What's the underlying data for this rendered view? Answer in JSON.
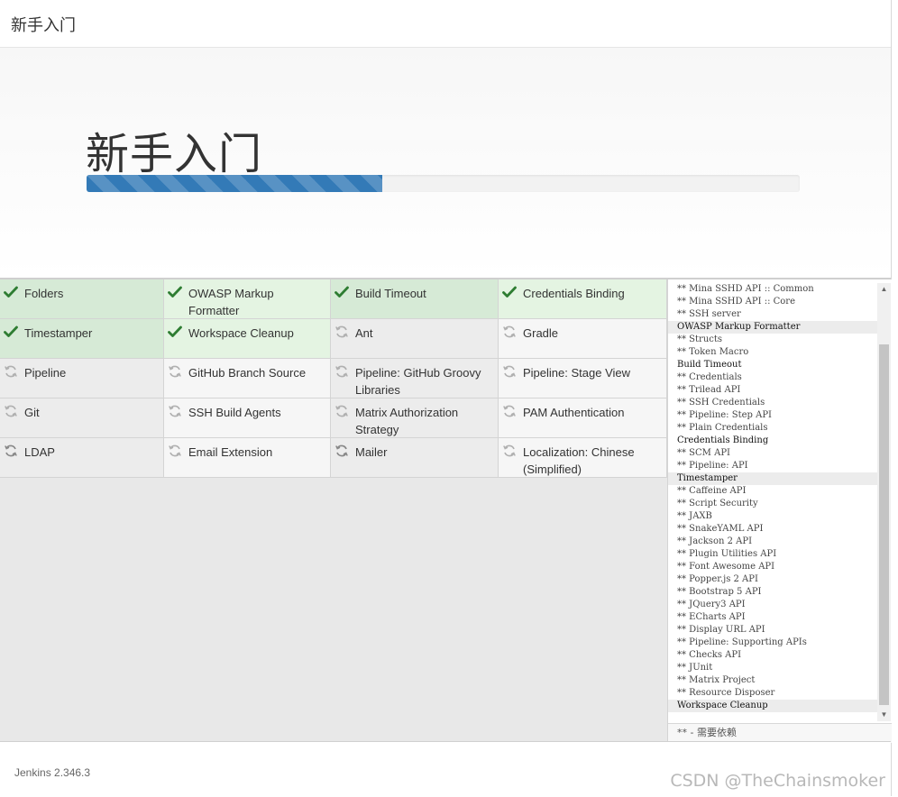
{
  "window_title": "新手入门",
  "hero": {
    "title": "新手入门",
    "progress_fraction": 0.415
  },
  "plugins": [
    {
      "label": "Folders",
      "status": "success"
    },
    {
      "label": "OWASP Markup Formatter",
      "status": "success"
    },
    {
      "label": "Build Timeout",
      "status": "success"
    },
    {
      "label": "Credentials Binding",
      "status": "success"
    },
    {
      "label": "Timestamper",
      "status": "success"
    },
    {
      "label": "Workspace Cleanup",
      "status": "success"
    },
    {
      "label": "Ant",
      "status": "pending"
    },
    {
      "label": "Gradle",
      "status": "pending"
    },
    {
      "label": "Pipeline",
      "status": "pending"
    },
    {
      "label": "GitHub Branch Source",
      "status": "pending"
    },
    {
      "label": "Pipeline: GitHub Groovy Libraries",
      "status": "pending"
    },
    {
      "label": "Pipeline: Stage View",
      "status": "pending"
    },
    {
      "label": "Git",
      "status": "pending"
    },
    {
      "label": "SSH Build Agents",
      "status": "pending"
    },
    {
      "label": "Matrix Authorization Strategy",
      "status": "pending"
    },
    {
      "label": "PAM Authentication",
      "status": "pending"
    },
    {
      "label": "LDAP",
      "status": "installing"
    },
    {
      "label": "Email Extension",
      "status": "pending"
    },
    {
      "label": "Mailer",
      "status": "installing"
    },
    {
      "label": "Localization: Chinese (Simplified)",
      "status": "pending"
    }
  ],
  "log": {
    "lines": [
      {
        "text": "** Mina SSHD API :: Common",
        "kind": "dep"
      },
      {
        "text": "** Mina SSHD API :: Core",
        "kind": "dep"
      },
      {
        "text": "** SSH server",
        "kind": "dep"
      },
      {
        "text": "OWASP Markup Formatter",
        "kind": "header",
        "highlight": true
      },
      {
        "text": "** Structs",
        "kind": "dep"
      },
      {
        "text": "** Token Macro",
        "kind": "dep"
      },
      {
        "text": "Build Timeout",
        "kind": "header"
      },
      {
        "text": "** Credentials",
        "kind": "dep"
      },
      {
        "text": "** Trilead API",
        "kind": "dep"
      },
      {
        "text": "** SSH Credentials",
        "kind": "dep"
      },
      {
        "text": "** Pipeline: Step API",
        "kind": "dep"
      },
      {
        "text": "** Plain Credentials",
        "kind": "dep"
      },
      {
        "text": "Credentials Binding",
        "kind": "header"
      },
      {
        "text": "** SCM API",
        "kind": "dep"
      },
      {
        "text": "** Pipeline: API",
        "kind": "dep"
      },
      {
        "text": "Timestamper",
        "kind": "header",
        "highlight": true
      },
      {
        "text": "** Caffeine API",
        "kind": "dep"
      },
      {
        "text": "** Script Security",
        "kind": "dep"
      },
      {
        "text": "** JAXB",
        "kind": "dep"
      },
      {
        "text": "** SnakeYAML API",
        "kind": "dep"
      },
      {
        "text": "** Jackson 2 API",
        "kind": "dep"
      },
      {
        "text": "** Plugin Utilities API",
        "kind": "dep"
      },
      {
        "text": "** Font Awesome API",
        "kind": "dep"
      },
      {
        "text": "** Popper.js 2 API",
        "kind": "dep"
      },
      {
        "text": "** Bootstrap 5 API",
        "kind": "dep"
      },
      {
        "text": "** JQuery3 API",
        "kind": "dep"
      },
      {
        "text": "** ECharts API",
        "kind": "dep"
      },
      {
        "text": "** Display URL API",
        "kind": "dep"
      },
      {
        "text": "** Pipeline: Supporting APIs",
        "kind": "dep"
      },
      {
        "text": "** Checks API",
        "kind": "dep"
      },
      {
        "text": "** JUnit",
        "kind": "dep"
      },
      {
        "text": "** Matrix Project",
        "kind": "dep"
      },
      {
        "text": "** Resource Disposer",
        "kind": "dep"
      },
      {
        "text": "Workspace Cleanup",
        "kind": "header",
        "highlight": true
      }
    ],
    "legend": "** - 需要依赖"
  },
  "footer": {
    "version": "Jenkins 2.346.3"
  },
  "watermark": "CSDN @TheChainsmoker",
  "colors": {
    "success": "#2e7d32",
    "pending": "#9a9a9a",
    "progress": "#337ab7"
  },
  "icons": {
    "success": "check-icon",
    "pending": "refresh-icon",
    "installing": "refresh-active-icon"
  }
}
